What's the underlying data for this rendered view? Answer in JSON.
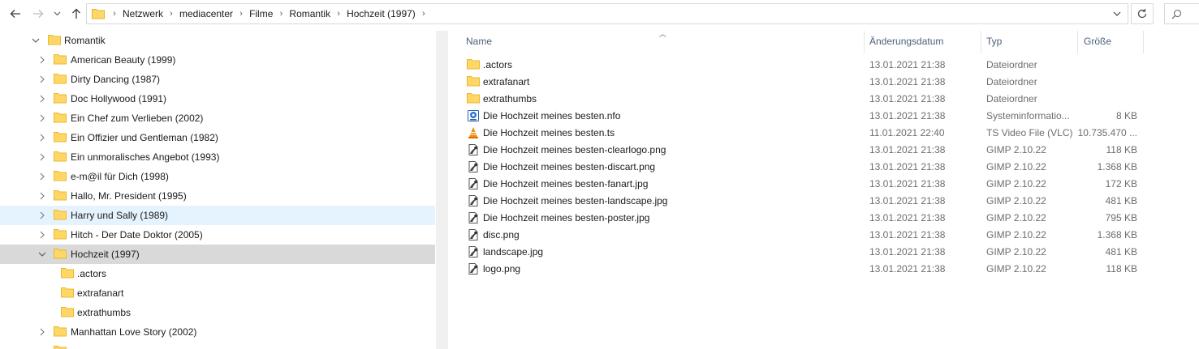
{
  "address": {
    "breadcrumbs": [
      "Netzwerk",
      "mediacenter",
      "Filme",
      "Romantik",
      "Hochzeit (1997)"
    ],
    "search_placeholder": ""
  },
  "tree": {
    "root": {
      "label": "Romantik",
      "expanded": true
    },
    "items": [
      {
        "label": "American Beauty (1999)",
        "level": 1,
        "expandable": true
      },
      {
        "label": "Dirty Dancing (1987)",
        "level": 1,
        "expandable": true
      },
      {
        "label": "Doc Hollywood (1991)",
        "level": 1,
        "expandable": true
      },
      {
        "label": "Ein Chef zum Verlieben (2002)",
        "level": 1,
        "expandable": true
      },
      {
        "label": "Ein Offizier und Gentleman (1982)",
        "level": 1,
        "expandable": true
      },
      {
        "label": "Ein unmoralisches Angebot (1993)",
        "level": 1,
        "expandable": true
      },
      {
        "label": "e-m@il für Dich (1998)",
        "level": 1,
        "expandable": true
      },
      {
        "label": "Hallo, Mr. President (1995)",
        "level": 1,
        "expandable": true
      },
      {
        "label": "Harry und Sally (1989)",
        "level": 1,
        "expandable": true,
        "state": "hover"
      },
      {
        "label": "Hitch - Der Date Doktor (2005)",
        "level": 1,
        "expandable": true
      },
      {
        "label": "Hochzeit (1997)",
        "level": 1,
        "expandable": true,
        "expanded": true,
        "state": "selected"
      },
      {
        "label": ".actors",
        "level": 2,
        "expandable": false
      },
      {
        "label": "extrafanart",
        "level": 2,
        "expandable": false
      },
      {
        "label": "extrathumbs",
        "level": 2,
        "expandable": false
      },
      {
        "label": "Manhattan Love Story (2002)",
        "level": 1,
        "expandable": true
      }
    ]
  },
  "columns": {
    "name": "Name",
    "date": "Änderungsdatum",
    "type": "Typ",
    "size": "Größe"
  },
  "files": [
    {
      "name": ".actors",
      "date": "13.01.2021 21:38",
      "type": "Dateiordner",
      "size": "",
      "icon": "folder-icon"
    },
    {
      "name": "extrafanart",
      "date": "13.01.2021 21:38",
      "type": "Dateiordner",
      "size": "",
      "icon": "folder-icon"
    },
    {
      "name": "extrathumbs",
      "date": "13.01.2021 21:38",
      "type": "Dateiordner",
      "size": "",
      "icon": "folder-icon"
    },
    {
      "name": "Die Hochzeit meines besten.nfo",
      "date": "13.01.2021 21:38",
      "type": "Systeminformatio...",
      "size": "8 KB",
      "icon": "nfo-icon"
    },
    {
      "name": "Die Hochzeit meines besten.ts",
      "date": "11.01.2021 22:40",
      "type": "TS Video File (VLC)",
      "size": "10.735.470 ...",
      "icon": "vlc-icon"
    },
    {
      "name": "Die Hochzeit meines besten-clearlogo.png",
      "date": "13.01.2021 21:38",
      "type": "GIMP 2.10.22",
      "size": "118 KB",
      "icon": "gimp-icon"
    },
    {
      "name": "Die Hochzeit meines besten-discart.png",
      "date": "13.01.2021 21:38",
      "type": "GIMP 2.10.22",
      "size": "1.368 KB",
      "icon": "gimp-icon"
    },
    {
      "name": "Die Hochzeit meines besten-fanart.jpg",
      "date": "13.01.2021 21:38",
      "type": "GIMP 2.10.22",
      "size": "172 KB",
      "icon": "gimp-icon"
    },
    {
      "name": "Die Hochzeit meines besten-landscape.jpg",
      "date": "13.01.2021 21:38",
      "type": "GIMP 2.10.22",
      "size": "481 KB",
      "icon": "gimp-icon"
    },
    {
      "name": "Die Hochzeit meines besten-poster.jpg",
      "date": "13.01.2021 21:38",
      "type": "GIMP 2.10.22",
      "size": "795 KB",
      "icon": "gimp-icon"
    },
    {
      "name": "disc.png",
      "date": "13.01.2021 21:38",
      "type": "GIMP 2.10.22",
      "size": "1.368 KB",
      "icon": "gimp-icon"
    },
    {
      "name": "landscape.jpg",
      "date": "13.01.2021 21:38",
      "type": "GIMP 2.10.22",
      "size": "481 KB",
      "icon": "gimp-icon"
    },
    {
      "name": "logo.png",
      "date": "13.01.2021 21:38",
      "type": "GIMP 2.10.22",
      "size": "118 KB",
      "icon": "gimp-icon"
    }
  ],
  "colors": {
    "folder": "#ffd766",
    "folder_dark": "#e8b830",
    "hover": "#e5f3ff",
    "selected": "#d9d9d9",
    "header_text": "#4c607a"
  }
}
